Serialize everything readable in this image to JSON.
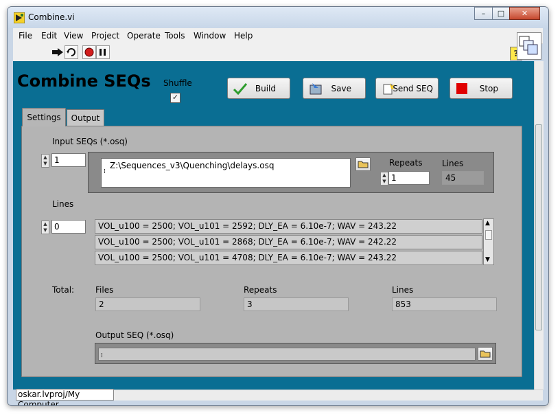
{
  "window": {
    "title": "Combine.vi",
    "minimize": "–",
    "maximize": "□",
    "close": "✕"
  },
  "menu": [
    "File",
    "Edit",
    "View",
    "Project",
    "Operate",
    "Tools",
    "Window",
    "Help"
  ],
  "toolbar": {
    "help": "?"
  },
  "app": {
    "title": "Combine SEQs",
    "shuffle_label": "Shuffle",
    "shuffle_checked": "✓",
    "buttons": {
      "build": "Build",
      "save": "Save",
      "send": "Send SEQ",
      "stop": "Stop"
    }
  },
  "tabs": [
    "Settings",
    "Output"
  ],
  "settings": {
    "input_label": "Input SEQs (*.osq)",
    "input_index": "1",
    "input_path": "Z:\\Sequences_v3\\Quenching\\delays.osq",
    "repeats_label": "Repeats",
    "repeats_value": "1",
    "lines_label": "Lines",
    "lines_value": "45",
    "lines_list_label": "Lines",
    "lines_index": "0",
    "lines": [
      "VOL_u100 = 2500; VOL_u101 = 2592; DLY_EA = 6.10e-7; WAV = 243.22",
      "VOL_u100 = 2500; VOL_u101 = 2868; DLY_EA = 6.10e-7; WAV = 242.22",
      "VOL_u100 = 2500; VOL_u101 = 4708; DLY_EA = 6.10e-7; WAV = 243.22"
    ],
    "total_label": "Total:",
    "files_label": "Files",
    "files_value": "2",
    "total_repeats_label": "Repeats",
    "total_repeats_value": "3",
    "total_lines_label": "Lines",
    "total_lines_value": "853",
    "output_label": "Output SEQ (*.osq)",
    "output_path": ""
  },
  "status_bar": {
    "context": "oskar.lvproj/My Computer"
  },
  "colors": {
    "panel": "#0a6e93",
    "tab_body": "#b4b4b4",
    "stop": "#e00000"
  }
}
